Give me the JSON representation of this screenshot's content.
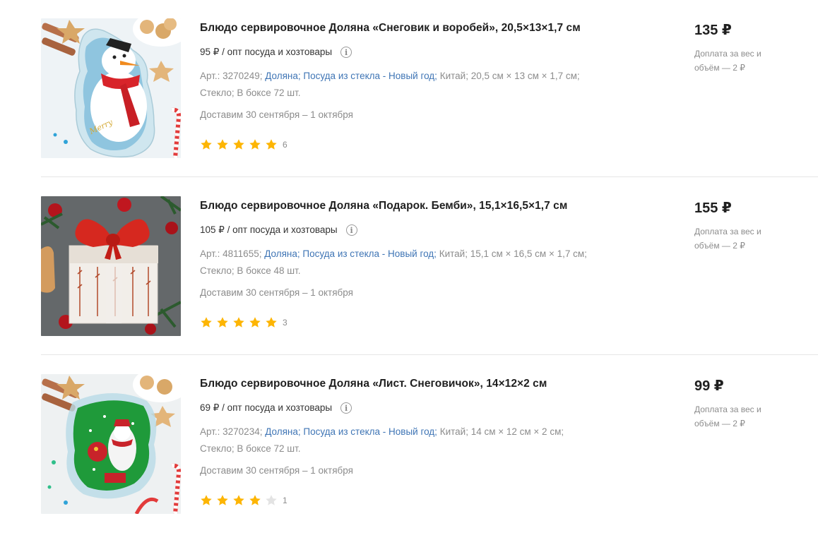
{
  "products": [
    {
      "title": "Блюдо сервировочное Доляна «Снеговик и воробей», 20,5×13×1,7 см",
      "wholesale_price": "95 ₽ / опт посуда и хозтовары",
      "info_glyph": "i",
      "article": "Арт.: 3270249;",
      "brand": "Доляна;",
      "category": "Посуда из стекла - Новый год;",
      "details_line1_tail": "Китай; 20,5 см × 13 см × 1,7 см;",
      "details_line2": "Стекло; В боксе 72 шт.",
      "delivery": "Доставим 30 сентября – 1 октября",
      "rating": 5,
      "reviews": "6",
      "price": "135 ₽",
      "surcharge": "Доплата за вес и объём — 2 ₽",
      "image": "snowman-glass-plate"
    },
    {
      "title": "Блюдо сервировочное Доляна «Подарок. Бемби», 15,1×16,5×1,7 см",
      "wholesale_price": "105 ₽ / опт посуда и хозтовары",
      "info_glyph": "i",
      "article": "Арт.: 4811655;",
      "brand": "Доляна;",
      "category": "Посуда из стекла - Новый год;",
      "details_line1_tail": "Китай; 15,1 см × 16,5 см × 1,7 см;",
      "details_line2": "Стекло; В боксе 48 шт.",
      "delivery": "Доставим 30 сентября – 1 октября",
      "rating": 5,
      "reviews": "3",
      "price": "155 ₽",
      "surcharge": "Доплата за вес и объём — 2 ₽",
      "image": "gift-box-plate"
    },
    {
      "title": "Блюдо сервировочное Доляна «Лист. Снеговичок», 14×12×2 см",
      "wholesale_price": "69 ₽ / опт посуда и хозтовары",
      "info_glyph": "i",
      "article": "Арт.: 3270234;",
      "brand": "Доляна;",
      "category": "Посуда из стекла - Новый год;",
      "details_line1_tail": "Китай; 14 см × 12 см × 2 см;",
      "details_line2": "Стекло; В боксе 72 шт.",
      "delivery": "Доставим 30 сентября – 1 октября",
      "rating": 4,
      "reviews": "1",
      "price": "99 ₽",
      "surcharge": "Доплата за вес и объём — 2 ₽",
      "image": "green-leaf-snowman-plate"
    }
  ],
  "colors": {
    "link": "#3f75b5",
    "star": "#fdb504",
    "star_empty": "#e3e3e3",
    "muted": "#8c8c8c",
    "divider": "#e6e6e6"
  }
}
